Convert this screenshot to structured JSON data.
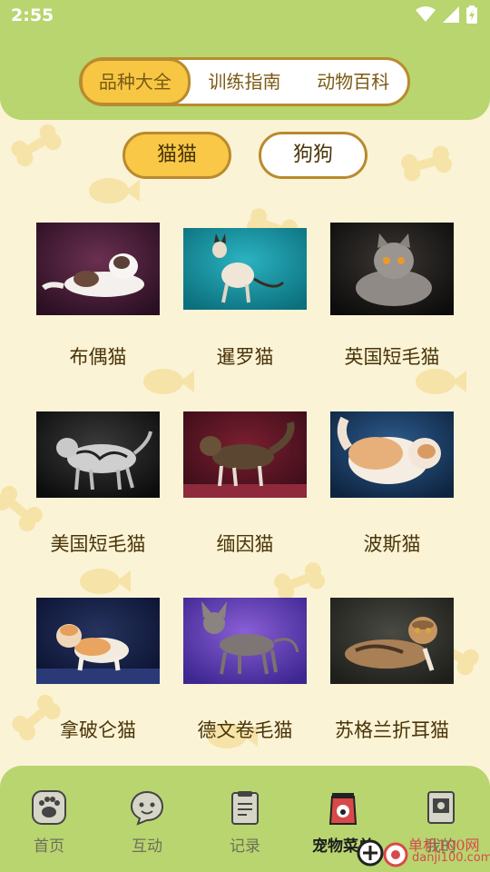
{
  "status_bar": {
    "time": "2:55"
  },
  "colors": {
    "header_green": "#b8d56f",
    "accent_yellow": "#f8c846",
    "border_brown": "#b98a2e",
    "background": "#fbf3d6"
  },
  "segment_tabs": [
    {
      "label": "品种大全",
      "active": true
    },
    {
      "label": "训练指南",
      "active": false
    },
    {
      "label": "动物百科",
      "active": false
    }
  ],
  "category_pills": [
    {
      "label": "猫猫",
      "selected": true
    },
    {
      "label": "狗狗",
      "selected": false
    }
  ],
  "breeds": [
    {
      "name": "布偶猫"
    },
    {
      "name": "暹罗猫"
    },
    {
      "name": "英国短毛猫"
    },
    {
      "name": "美国短毛猫"
    },
    {
      "name": "缅因猫"
    },
    {
      "name": "波斯猫"
    },
    {
      "name": "拿破仑猫"
    },
    {
      "name": "德文卷毛猫"
    },
    {
      "name": "苏格兰折耳猫"
    }
  ],
  "bottom_nav": [
    {
      "label": "首页",
      "icon": "paw-icon",
      "active": false
    },
    {
      "label": "互动",
      "icon": "chat-face-icon",
      "active": false
    },
    {
      "label": "记录",
      "icon": "record-icon",
      "active": false
    },
    {
      "label": "宠物菜单",
      "icon": "pet-food-bag-icon",
      "active": true
    },
    {
      "label": "我的",
      "icon": "profile-icon",
      "active": false
    }
  ],
  "watermark": {
    "text": "单机100网",
    "url": "danji100.com"
  }
}
